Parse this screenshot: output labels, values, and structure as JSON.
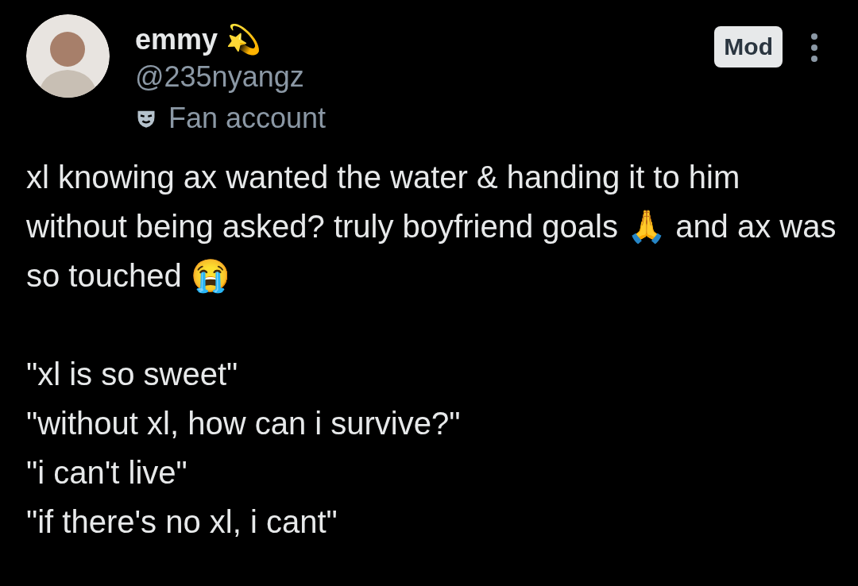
{
  "author": {
    "name": "emmy 💫",
    "handle": "@235nyangz",
    "label": "Fan account",
    "badge": "Mod"
  },
  "body": {
    "paragraphs": [
      "xl knowing ax wanted the water & handing it to him without being asked? truly boyfriend goals 🙏 and ax was so touched 😭"
    ],
    "quotes": [
      "\"xl is so sweet\"",
      "\"without xl, how can i survive?\"",
      "\"i can't live\"",
      "\"if there's no xl, i cant\""
    ]
  }
}
